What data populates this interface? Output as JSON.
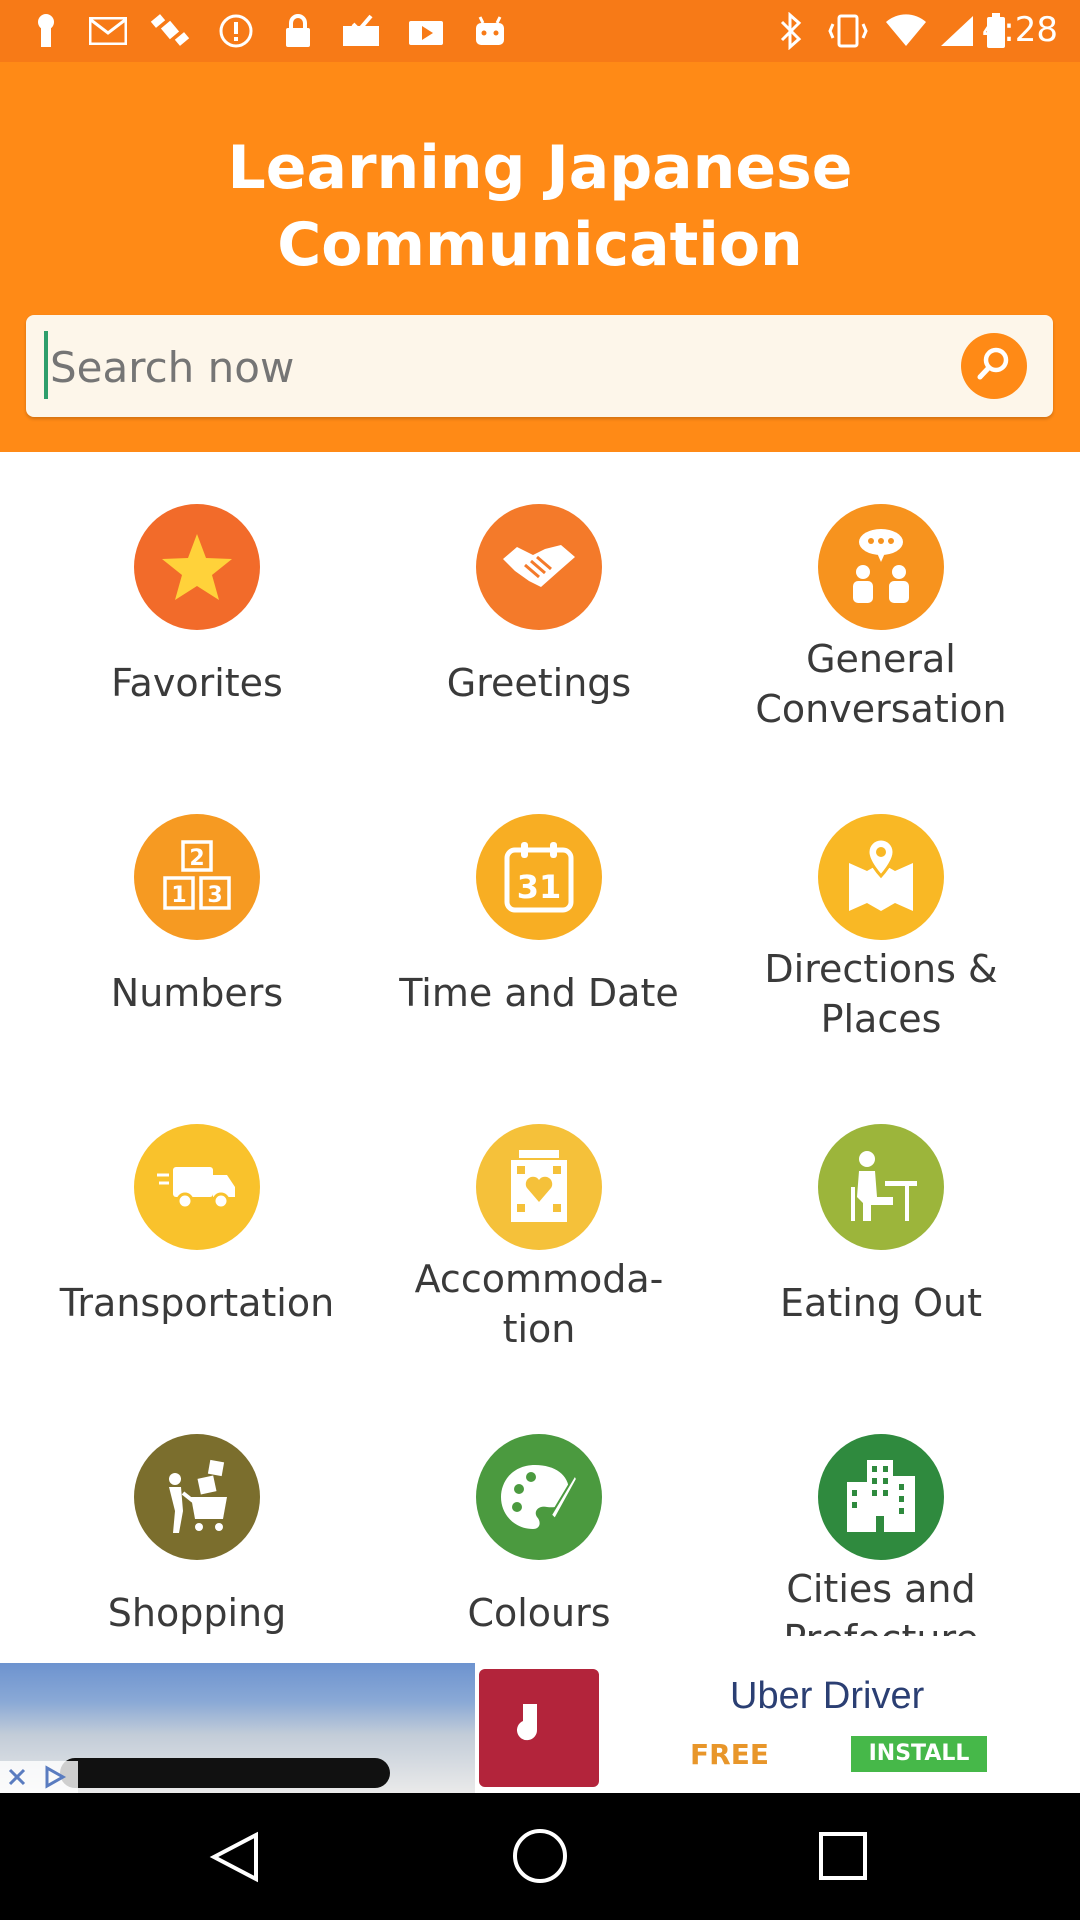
{
  "status_bar": {
    "time": "4:28",
    "left_icons": [
      "keyhole-icon",
      "mail-icon",
      "satellite-icon",
      "alert-icon",
      "lock-icon",
      "mail-check-icon",
      "briefcase-play-icon",
      "android-icon"
    ],
    "right_icons": [
      "bluetooth-icon",
      "vibrate-icon",
      "wifi-icon",
      "signal-icon",
      "battery-icon"
    ]
  },
  "header": {
    "title_line1": "Learning Japanese",
    "title_line2": "Communication",
    "search_placeholder": "Search now"
  },
  "categories": [
    {
      "label": "Favorites",
      "icon": "star-icon",
      "color": "#f26b2a"
    },
    {
      "label": "Greetings",
      "icon": "handshake-icon",
      "color": "#f47a2a"
    },
    {
      "label_line1": "General",
      "label_line2": "Conversation",
      "icon": "conversation-icon",
      "color": "#f7931e"
    },
    {
      "label": "Numbers",
      "icon": "number-blocks-icon",
      "color": "#f69a22"
    },
    {
      "label": "Time and Date",
      "icon": "calendar-icon",
      "calendar_day": "31",
      "color": "#f8ae23"
    },
    {
      "label_line1": "Directions &",
      "label_line2": "Places",
      "icon": "map-pin-icon",
      "color": "#f9b825"
    },
    {
      "label": "Transportation",
      "icon": "truck-icon",
      "color": "#f9c22c"
    },
    {
      "label_line1": "Accommoda-",
      "label_line2": "tion",
      "icon": "hotel-icon",
      "color": "#f5c13a"
    },
    {
      "label": "Eating Out",
      "icon": "dining-icon",
      "color": "#9cb53b"
    },
    {
      "label": "Shopping",
      "icon": "shopping-cart-icon",
      "color": "#7b6e2d"
    },
    {
      "label": "Colours",
      "icon": "palette-icon",
      "color": "#4b9a3f"
    },
    {
      "label_line1": "Cities and",
      "label_line2": "Prefecture",
      "icon": "city-icon",
      "color": "#2f8a3e"
    }
  ],
  "ad": {
    "title": "Uber Driver",
    "free_label": "FREE",
    "install_label": "INSTALL"
  },
  "colors": {
    "status_bar": "#f77a17",
    "header": "#ff8a16",
    "search_bg": "#fdf6ea"
  }
}
